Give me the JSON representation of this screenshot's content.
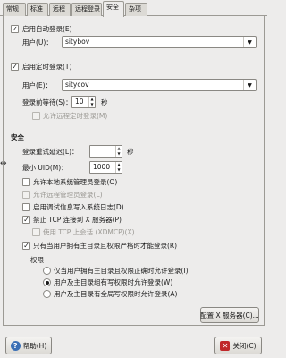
{
  "tabs": [
    {
      "label": "常规"
    },
    {
      "label": "标准"
    },
    {
      "label": "远程"
    },
    {
      "label": "远程登录"
    },
    {
      "label": "安全"
    },
    {
      "label": "杂项"
    }
  ],
  "active_tab_index": 4,
  "auto_login": {
    "enable_label": "启用自动登录(E)",
    "enabled": true,
    "user_label": "用户(U)：",
    "user_value": "sitybov"
  },
  "timed_login": {
    "enable_label": "启用定时登录(T)",
    "enabled": true,
    "user_label": "用户(E)：",
    "user_value": "sitycov",
    "delay_label": "登录前等待(S)：",
    "delay_value": "10",
    "delay_unit": "秒",
    "allow_remote_label": "允许远程定时登录(M)",
    "allow_remote_checked": false
  },
  "security": {
    "section_title": "安全",
    "retry_delay_label": "登录重试延迟(L)：",
    "retry_delay_value": "",
    "retry_delay_unit": "秒",
    "max_uid_label": "最小 UID(M)：",
    "max_uid_value": "1000",
    "options": [
      {
        "label": "允许本地系统管理员登录(O)",
        "checked": false,
        "disabled": false
      },
      {
        "label": "允许远程管理员登录(L)",
        "checked": false,
        "disabled": true
      },
      {
        "label": "启用调试信息写入系统日志(D)",
        "checked": false,
        "disabled": false
      },
      {
        "label": "禁止 TCP 连接到 X 服务器(P)",
        "checked": true,
        "disabled": false
      },
      {
        "label": "使用 TCP 上会话 (XDMCP)(X)",
        "checked": false,
        "disabled": true
      }
    ],
    "deny_label": "只有当用户拥有主目录且权限严格时才能登录(R)",
    "deny_checked": true
  },
  "permissions": {
    "title": "权限",
    "radios": [
      {
        "label": "仅当用户拥有主目录且权限正确时允许登录(I)",
        "selected": false
      },
      {
        "label": "用户及主目录组有写权限时允许登录(W)",
        "selected": true
      },
      {
        "label": "用户及主目录有全局写权限时允许登录(A)",
        "selected": false
      }
    ]
  },
  "configure_button_label": "配置 X 服务器(C)...",
  "help_button_label": "帮助(H)",
  "close_button_label": "关闭(C)",
  "colors": {
    "help_icon": "#3a6fb5",
    "close_icon": "#c0282a"
  }
}
